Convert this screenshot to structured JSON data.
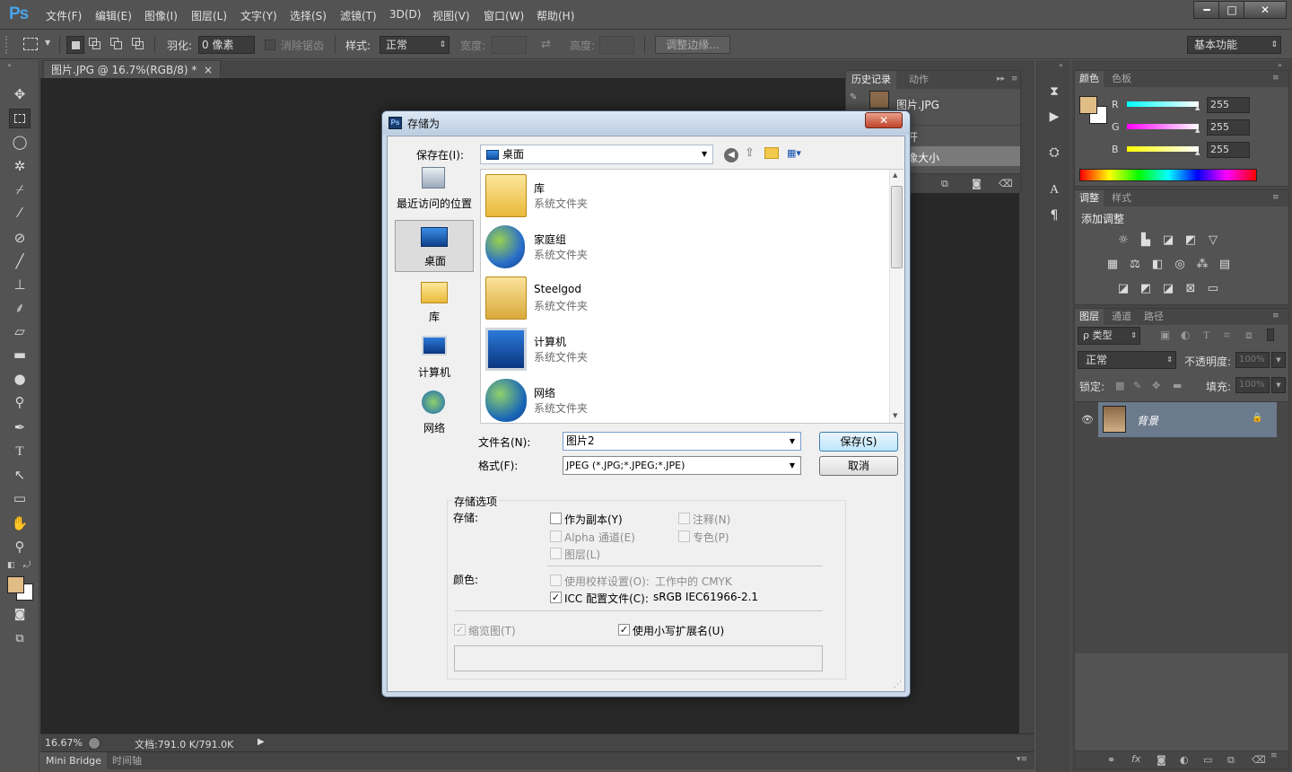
{
  "app": {
    "logo": "Ps"
  },
  "menu": [
    "文件(F)",
    "编辑(E)",
    "图像(I)",
    "图层(L)",
    "文字(Y)",
    "选择(S)",
    "滤镜(T)",
    "3D(D)",
    "视图(V)",
    "窗口(W)",
    "帮助(H)"
  ],
  "window_controls": {
    "minimize": "━",
    "maximize": "□",
    "close": "✕"
  },
  "options_bar": {
    "feather_label": "羽化:",
    "feather_value": "0 像素",
    "antialias_label": "消除锯齿",
    "style_label": "样式:",
    "style_value": "正常",
    "width_label": "宽度:",
    "height_label": "高度:",
    "refine_edge": "调整边缘...",
    "workspace": "基本功能"
  },
  "document": {
    "tab_title": "图片.JPG @ 16.7%(RGB/8) *",
    "tab_close": "×",
    "zoom": "16.67%",
    "doc_size": "文档:791.0 K/791.0K"
  },
  "bottom_tabs": [
    "Mini Bridge",
    "时间轴"
  ],
  "history_panel": {
    "tabs": [
      "历史记录",
      "动作"
    ],
    "snapshot": "图片.JPG",
    "items": [
      "打开",
      "图像大小"
    ]
  },
  "color_panel": {
    "tabs": [
      "颜色",
      "色板"
    ],
    "r_label": "R",
    "g_label": "G",
    "b_label": "B",
    "r_value": "255",
    "g_value": "255",
    "b_value": "255",
    "foreground_color": "#e1bd86"
  },
  "adjust_panel": {
    "tabs": [
      "调整",
      "样式"
    ],
    "title": "添加调整"
  },
  "layers_panel": {
    "tabs": [
      "图层",
      "通道",
      "路径"
    ],
    "filter_type": "ρ 类型",
    "blend_mode": "正常",
    "opacity_label": "不透明度:",
    "opacity_value": "100%",
    "lock_label": "锁定:",
    "fill_label": "填充:",
    "fill_value": "100%",
    "layer_name": "背景"
  },
  "dialog": {
    "title": "存储为",
    "close": "✕",
    "save_in_label": "保存在(I):",
    "save_in_value": "桌面",
    "places": [
      "最近访问的位置",
      "桌面",
      "库",
      "计算机",
      "网络"
    ],
    "files": [
      {
        "name": "库",
        "desc": "系统文件夹"
      },
      {
        "name": "家庭组",
        "desc": "系统文件夹"
      },
      {
        "name": "Steelgod",
        "desc": "系统文件夹"
      },
      {
        "name": "计算机",
        "desc": "系统文件夹"
      },
      {
        "name": "网络",
        "desc": "系统文件夹"
      }
    ],
    "filename_label": "文件名(N):",
    "filename_value": "图片2",
    "format_label": "格式(F):",
    "format_value": "JPEG (*.JPG;*.JPEG;*.JPE)",
    "save_button": "保存(S)",
    "cancel_button": "取消",
    "options_group": "存储选项",
    "store_label": "存储:",
    "as_copy": "作为副本(Y)",
    "notes": "注释(N)",
    "alpha": "Alpha 通道(E)",
    "spot": "专色(P)",
    "layers": "图层(L)",
    "color_label": "颜色:",
    "use_proof": "使用校样设置(O):",
    "proof_value": "工作中的 CMYK",
    "icc_profile": "ICC 配置文件(C):",
    "icc_value": "sRGB IEC61966-2.1",
    "thumbnail": "缩览图(T)",
    "lowercase_ext": "使用小写扩展名(U)"
  }
}
